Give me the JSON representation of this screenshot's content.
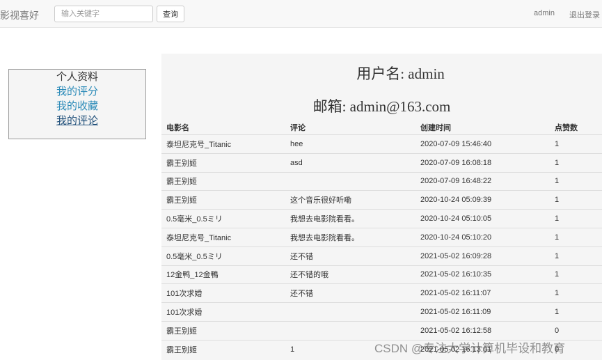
{
  "navbar": {
    "brand": "影视喜好",
    "search_placeholder": "输入关键字",
    "search_button": "查询",
    "user": "admin",
    "logout": "退出登录"
  },
  "sidebar": {
    "items": [
      {
        "label": "个人资料"
      },
      {
        "label": "我的评分"
      },
      {
        "label": "我的收藏"
      },
      {
        "label": "我的评论"
      }
    ]
  },
  "profile": {
    "username_line": "用户名: admin",
    "email_line": "邮箱: admin@163.com"
  },
  "table": {
    "headers": [
      "电影名",
      "评论",
      "创建时间",
      "点赞数"
    ],
    "rows": [
      [
        "泰坦尼克号_Titanic",
        "hee",
        "2020-07-09 15:46:40",
        "1"
      ],
      [
        "霸王别姬",
        "asd",
        "2020-07-09 16:08:18",
        "1"
      ],
      [
        "霸王别姬",
        "",
        "2020-07-09 16:48:22",
        "1"
      ],
      [
        "霸王别姬",
        "这个音乐很好听嘞",
        "2020-10-24 05:09:39",
        "1"
      ],
      [
        "0.5毫米_0.5ミリ",
        "我想去电影院看看。",
        "2020-10-24 05:10:05",
        "1"
      ],
      [
        "泰坦尼克号_Titanic",
        "我想去电影院看看。",
        "2020-10-24 05:10:20",
        "1"
      ],
      [
        "0.5毫米_0.5ミリ",
        "还不错",
        "2021-05-02 16:09:28",
        "1"
      ],
      [
        "12金鸭_12金鴨",
        "还不错的哦",
        "2021-05-02 16:10:35",
        "1"
      ],
      [
        "101次求婚",
        "还不错",
        "2021-05-02 16:11:07",
        "1"
      ],
      [
        "101次求婚",
        "",
        "2021-05-02 16:11:09",
        "1"
      ],
      [
        "霸王别姬",
        "",
        "2021-05-02 16:12:58",
        "0"
      ],
      [
        "霸王别姬",
        "1",
        "2021-05-02 16:13:01",
        "0"
      ]
    ]
  },
  "watermark": "CSDN @专注大学计算机毕设和教育"
}
